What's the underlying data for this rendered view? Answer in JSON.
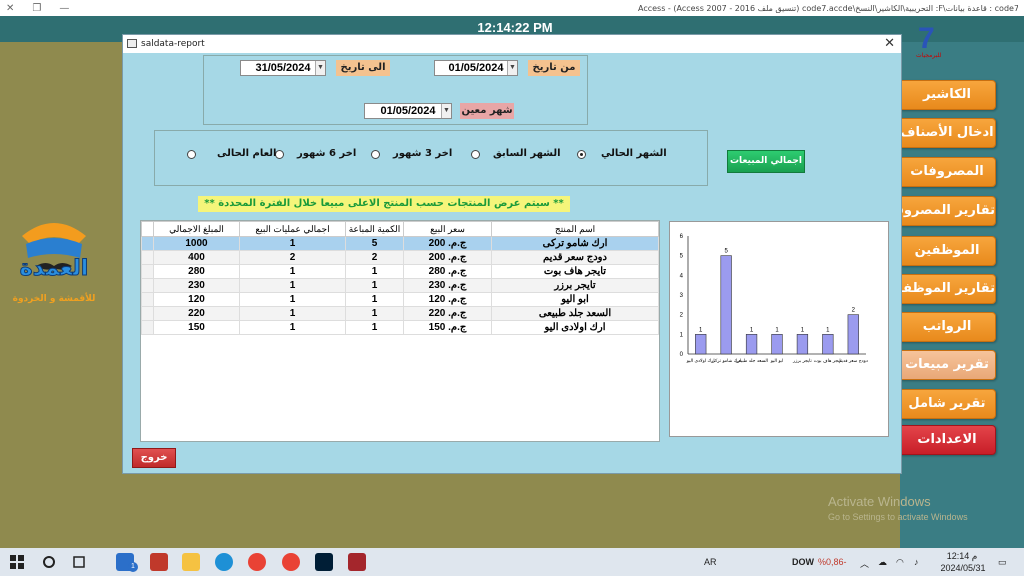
{
  "app_title": "Access - (Access 2007 - 2016 تنسيق ملف) code7.accde\\التحريبية\\الكاشير\\النسخ :F\\قاعدة بيانات : code7",
  "clock": "12:14:22 PM",
  "logo": {
    "main": "7",
    "sub": "للبرمجيات"
  },
  "brand": {
    "line1": "العمدة",
    "line2": "للأقمشة و الخردوة"
  },
  "nav_buttons": [
    "الكاشير",
    "ادخال الأصناف",
    "المصروفات",
    "تقارير المصروفات",
    "الموظفين",
    "تقارير الموظفين",
    "الرواتب",
    "تقرير مبيعات",
    "تقرير شامل",
    "الاعدادات"
  ],
  "dialog": {
    "title": "saldata-report",
    "to_date_label": "الى تاريخ",
    "to_date": "31/05/2024",
    "from_date_label": "من تاريخ",
    "from_date": "01/05/2024",
    "month_label": "شهر معين",
    "month_date": "01/05/2024",
    "radios": [
      {
        "label": "الشهر الحالي",
        "checked": true
      },
      {
        "label": "الشهر السابق",
        "checked": false
      },
      {
        "label": "اخر 3 شهور",
        "checked": false
      },
      {
        "label": "اخر 6 شهور",
        "checked": false
      },
      {
        "label": "العام الحالى",
        "checked": false
      }
    ],
    "total_sales_button": "اجمالي المبيعات",
    "notice": "**  سيتم عرض المنتجات حسب المنتج الاعلى مبيعا خلال الفترة المحددة  **",
    "exit_button": "خروج",
    "table": {
      "headers": [
        "اسم المنتج",
        "سعر البيع",
        "الكمية المباعة",
        "اجمالي عمليات البيع",
        "المبلغ الاجمالي"
      ],
      "rows": [
        [
          "ارك شامو تركى",
          "ج.م. 200",
          "5",
          "1",
          "1000"
        ],
        [
          "دودج سعر قديم",
          "ج.م. 200",
          "2",
          "2",
          "400"
        ],
        [
          "تايجر هاف بوت",
          "ج.م. 280",
          "1",
          "1",
          "280"
        ],
        [
          "تايجر برزر",
          "ج.م. 230",
          "1",
          "1",
          "230"
        ],
        [
          "ابو اليو",
          "ج.م. 120",
          "1",
          "1",
          "120"
        ],
        [
          "السعد جلد طبيعى",
          "ج.م. 220",
          "1",
          "1",
          "220"
        ],
        [
          "ارك اولادى اليو",
          "ج.م. 150",
          "1",
          "1",
          "150"
        ]
      ]
    }
  },
  "chart_data": {
    "type": "bar",
    "categories": [
      "ارك اولادى اليو",
      "ارك شامو تركى",
      "السعد جلد طبيعى",
      "ابو اليو",
      "تايجر برزر",
      "تايجر هاف بوت",
      "دودج سعر قديم"
    ],
    "values": [
      1,
      5,
      1,
      1,
      1,
      1,
      2
    ],
    "y_ticks": [
      "0",
      "1",
      "2",
      "3",
      "4",
      "5",
      "6"
    ],
    "ylim": [
      0,
      6
    ],
    "bar_color": "#9b9bef"
  },
  "watermark": {
    "line1": "Activate Windows",
    "line2": "Go to Settings to activate Windows"
  },
  "taskbar": {
    "lang": "AR",
    "ticker": "DOW",
    "ticker_change": "%0,86-",
    "time": "12:14 م",
    "date": "2024/05/31",
    "mail_badge": "1"
  },
  "colors": {
    "teal": "#2f6f72",
    "dialog_bg": "#a6d8e6",
    "nav_orange": "#f29a2e",
    "nav_red": "#c81e28"
  }
}
